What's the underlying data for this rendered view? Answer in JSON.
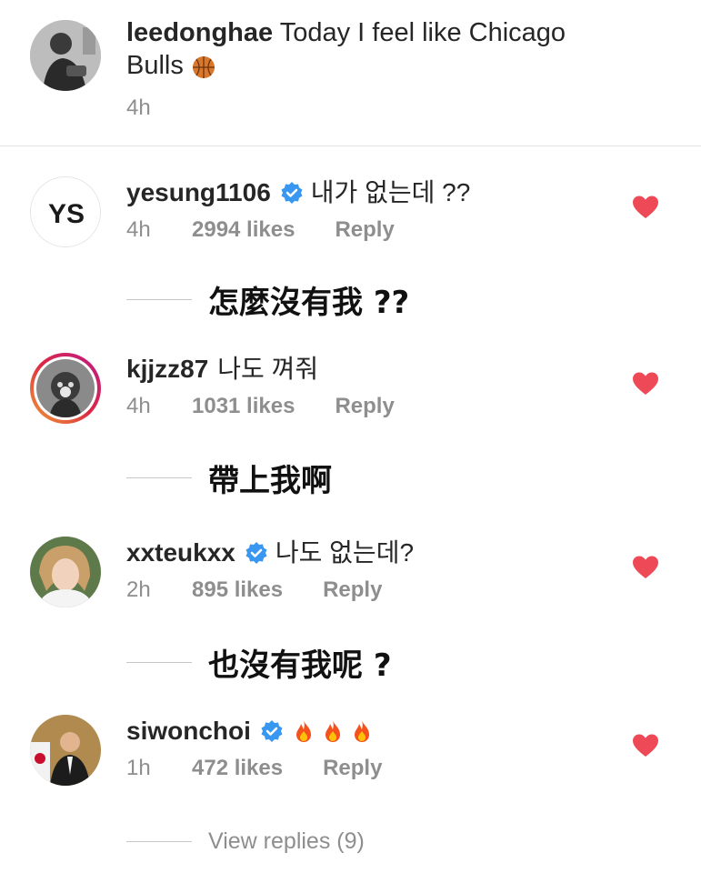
{
  "caption": {
    "username": "leedonghae",
    "text_line1": "Today I feel like Chicago",
    "text_line2": "Bulls",
    "emoji": "basketball-icon",
    "time": "4h"
  },
  "comments": [
    {
      "username": "yesung1106",
      "verified": true,
      "text": "내가 없는데 ??",
      "time": "4h",
      "likes": "2994 likes",
      "reply": "Reply",
      "translation": "怎麼沒有我 ??",
      "avatar_initials": "YS"
    },
    {
      "username": "kjjzz87",
      "verified": false,
      "text": "나도 껴줘",
      "time": "4h",
      "likes": "1031 likes",
      "reply": "Reply",
      "translation": "帶上我啊"
    },
    {
      "username": "xxteukxx",
      "verified": true,
      "text": "나도 없는데?",
      "time": "2h",
      "likes": "895 likes",
      "reply": "Reply",
      "translation": "也沒有我呢 ?"
    },
    {
      "username": "siwonchoi",
      "verified": true,
      "text_emoji": "fire-icon x3",
      "time": "1h",
      "likes": "472 likes",
      "reply": "Reply"
    }
  ],
  "view_replies": "View replies (9)",
  "colors": {
    "heart": "#ed4956",
    "verified": "#3897f0",
    "meta_gray": "#8e8e8e",
    "text": "#262626"
  }
}
